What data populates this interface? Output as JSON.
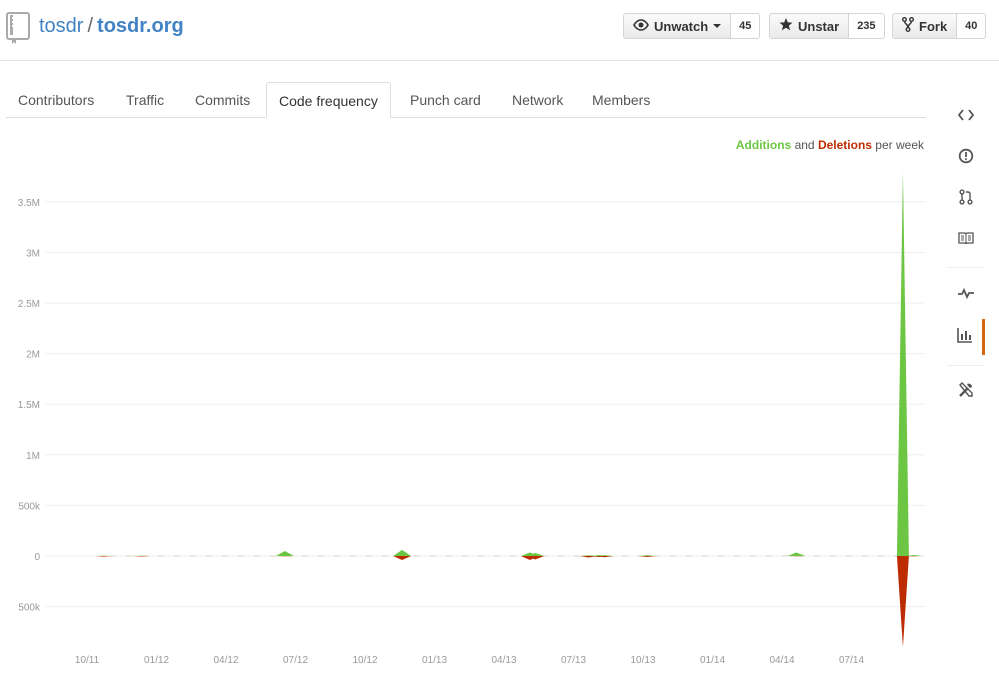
{
  "repo": {
    "owner": "tosdr",
    "separator": "/",
    "name": "tosdr.org"
  },
  "actions": {
    "watch": {
      "label": "Unwatch",
      "count": "45"
    },
    "star": {
      "label": "Unstar",
      "count": "235"
    },
    "fork": {
      "label": "Fork",
      "count": "40"
    }
  },
  "tabs": [
    {
      "label": "Contributors"
    },
    {
      "label": "Traffic"
    },
    {
      "label": "Commits"
    },
    {
      "label": "Code frequency",
      "selected": true
    },
    {
      "label": "Punch card"
    },
    {
      "label": "Network"
    },
    {
      "label": "Members"
    }
  ],
  "legend": {
    "additions": "Additions",
    "and": "and",
    "deletions": "Deletions",
    "suffix": "per week"
  },
  "sidebar_icons": [
    "code-icon",
    "issues-icon",
    "pull-requests-icon",
    "wiki-icon",
    "pulse-icon",
    "graphs-icon",
    "settings-icon"
  ],
  "colors": {
    "additions": "#6cc644",
    "deletions": "#bd2c00",
    "link": "#4183c4",
    "active_tab_marker": "#d26911"
  },
  "chart_data": {
    "type": "area",
    "title": "Additions and Deletions per week",
    "y_ticks": [
      "3.5M",
      "3M",
      "2.5M",
      "2M",
      "1.5M",
      "1M",
      "500k",
      "0",
      "500k"
    ],
    "ylim": [
      -500000,
      3500000
    ],
    "x_ticks": [
      "10/11",
      "01/12",
      "04/12",
      "07/12",
      "10/12",
      "01/13",
      "04/13",
      "07/13",
      "10/13",
      "01/14",
      "04/14",
      "07/14"
    ],
    "series": [
      {
        "name": "Additions",
        "x": [
          "2011-10-23",
          "2011-12-11",
          "2012-06-17",
          "2012-11-18",
          "2013-05-05",
          "2013-05-12",
          "2013-07-21",
          "2013-08-04",
          "2013-08-11",
          "2013-10-06",
          "2014-04-20",
          "2014-09-07",
          "2014-09-21"
        ],
        "values": [
          2000,
          3000,
          50000,
          60000,
          35000,
          30000,
          8000,
          10000,
          9000,
          8000,
          35000,
          3800000,
          10000
        ]
      },
      {
        "name": "Deletions",
        "x": [
          "2011-10-23",
          "2011-12-11",
          "2012-06-17",
          "2012-11-18",
          "2013-05-05",
          "2013-05-12",
          "2013-07-21",
          "2013-08-04",
          "2013-08-11",
          "2013-10-06",
          "2014-04-20",
          "2014-09-07",
          "2014-09-21"
        ],
        "values": [
          -6000,
          -5000,
          -3000,
          -40000,
          -40000,
          -35000,
          -15000,
          -10000,
          -12000,
          -10000,
          -2000,
          -900000,
          -3000
        ]
      }
    ]
  }
}
